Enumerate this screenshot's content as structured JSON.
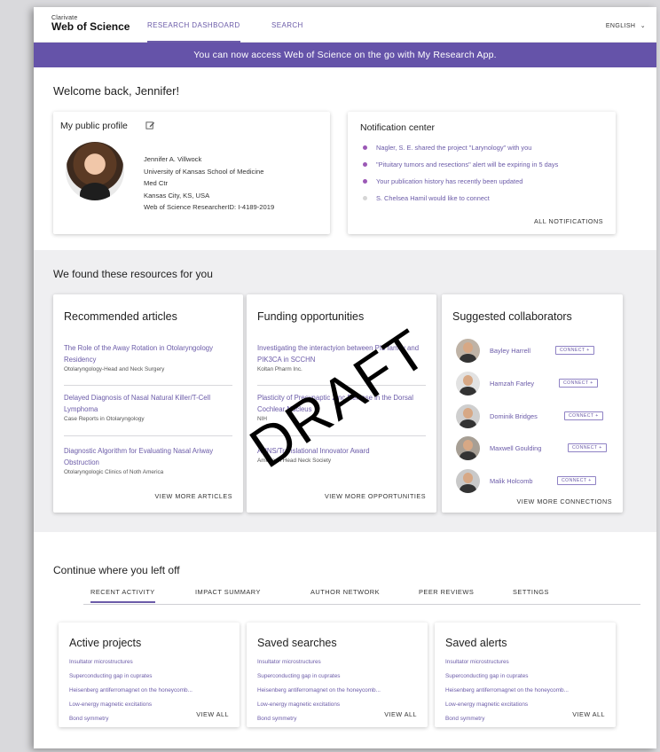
{
  "header": {
    "logo_top": "Clarivate",
    "logo_main": "Web of Science",
    "tabs": [
      "RESEARCH DASHBOARD",
      "SEARCH"
    ],
    "language": "ENGLISH"
  },
  "banner": "You can now access Web of Science on the go with My Research App.",
  "welcome": "Welcome back, Jennifer!",
  "profile": {
    "title": "My public profile",
    "lines": [
      "Jennifer A. Villwock",
      "University of Kansas School of Medicine",
      "Med Ctr",
      "Kansas City, KS, USA",
      "Web of Science ResearcherID: I-4189-2019"
    ]
  },
  "notifications": {
    "title": "Notification center",
    "items": [
      "Nagler, S. E. shared the project \"Larynology\" with you",
      "\"Pituitary tumors and resections\" alert will be expiring in 5 days",
      "Your publication history has recently been updated",
      "S. Chelsea Hamil would like to connect"
    ],
    "all_link": "ALL NOTIFICATIONS"
  },
  "resources": {
    "title": "We found these resources for you",
    "articles": {
      "title": "Recommended articles",
      "items": [
        {
          "title": "The Role of the Away Rotation in Otolaryngology Residency",
          "source": "Otolaryngology-Head and Neck Surgery"
        },
        {
          "title": "Delayed Diagnosis of Nasal Natural Killer/T-Cell Lymphoma",
          "source": "Case Reports in Otolaryngology"
        },
        {
          "title": "Diagnostic Algorithm for Evaluating Nasal Ariway Obstruction",
          "source": "Otolaryngologic Clinics of Noth America"
        }
      ],
      "more": "VIEW MORE ARTICLES"
    },
    "funding": {
      "title": "Funding opportunities",
      "items": [
        {
          "title": "Investigating the interactyion between PI3 family and PIK3CA in SCCHN",
          "source": "Koltan Pharm Inc."
        },
        {
          "title": "Plasticity of Presynaptic Zinc Release in the Dorsal Cochlear Nucleus",
          "source": "NIH"
        },
        {
          "title": "AHNS/Translational Innovator Award",
          "source": "American Head Neck Society"
        }
      ],
      "more": "VIEW MORE OPPORTUNITIES"
    },
    "collaborators": {
      "title": "Suggested collaborators",
      "connect_label": "CONNECT +",
      "people": [
        "Bayley Harrell",
        "Hamzah Farley",
        "Dominik Bridges",
        "Maxwell Goulding",
        "Malik Holcomb"
      ],
      "more": "VIEW MORE CONNECTIONS"
    }
  },
  "watermark": "DRAFT",
  "continue": {
    "title": "Continue where you left off",
    "tabs": [
      "RECENT ACTIVITY",
      "IMPACT SUMMARY",
      "AUTHOR NETWORK",
      "PEER REVIEWS",
      "SETTINGS"
    ],
    "cards": [
      {
        "title": "Active projects",
        "items": [
          "Insultator microstructures",
          "Superconducting gap in cuprates",
          "Heisenberg antiferromagnet on the honeycomb...",
          "Low-energy magnetic excitations",
          "Bond symmetry"
        ],
        "link": "VIEW ALL"
      },
      {
        "title": "Saved searches",
        "items": [
          "Insultator microstructures",
          "Superconducting gap in cuprates",
          "Heisenberg antiferromagnet on the honeycomb...",
          "Low-energy magnetic excitations",
          "Bond symmetry"
        ],
        "link": "VIEW ALL"
      },
      {
        "title": "Saved alerts",
        "items": [
          "Insultator microstructures",
          "Superconducting gap in cuprates",
          "Heisenberg antiferromagnet on the honeycomb...",
          "Low-energy magnetic excitations",
          "Bond symmetry"
        ],
        "link": "VIEW ALL"
      }
    ]
  },
  "colors": {
    "accent": "#6553a9",
    "link": "#6b5ba8",
    "unread_dot": "#9b59b6"
  }
}
